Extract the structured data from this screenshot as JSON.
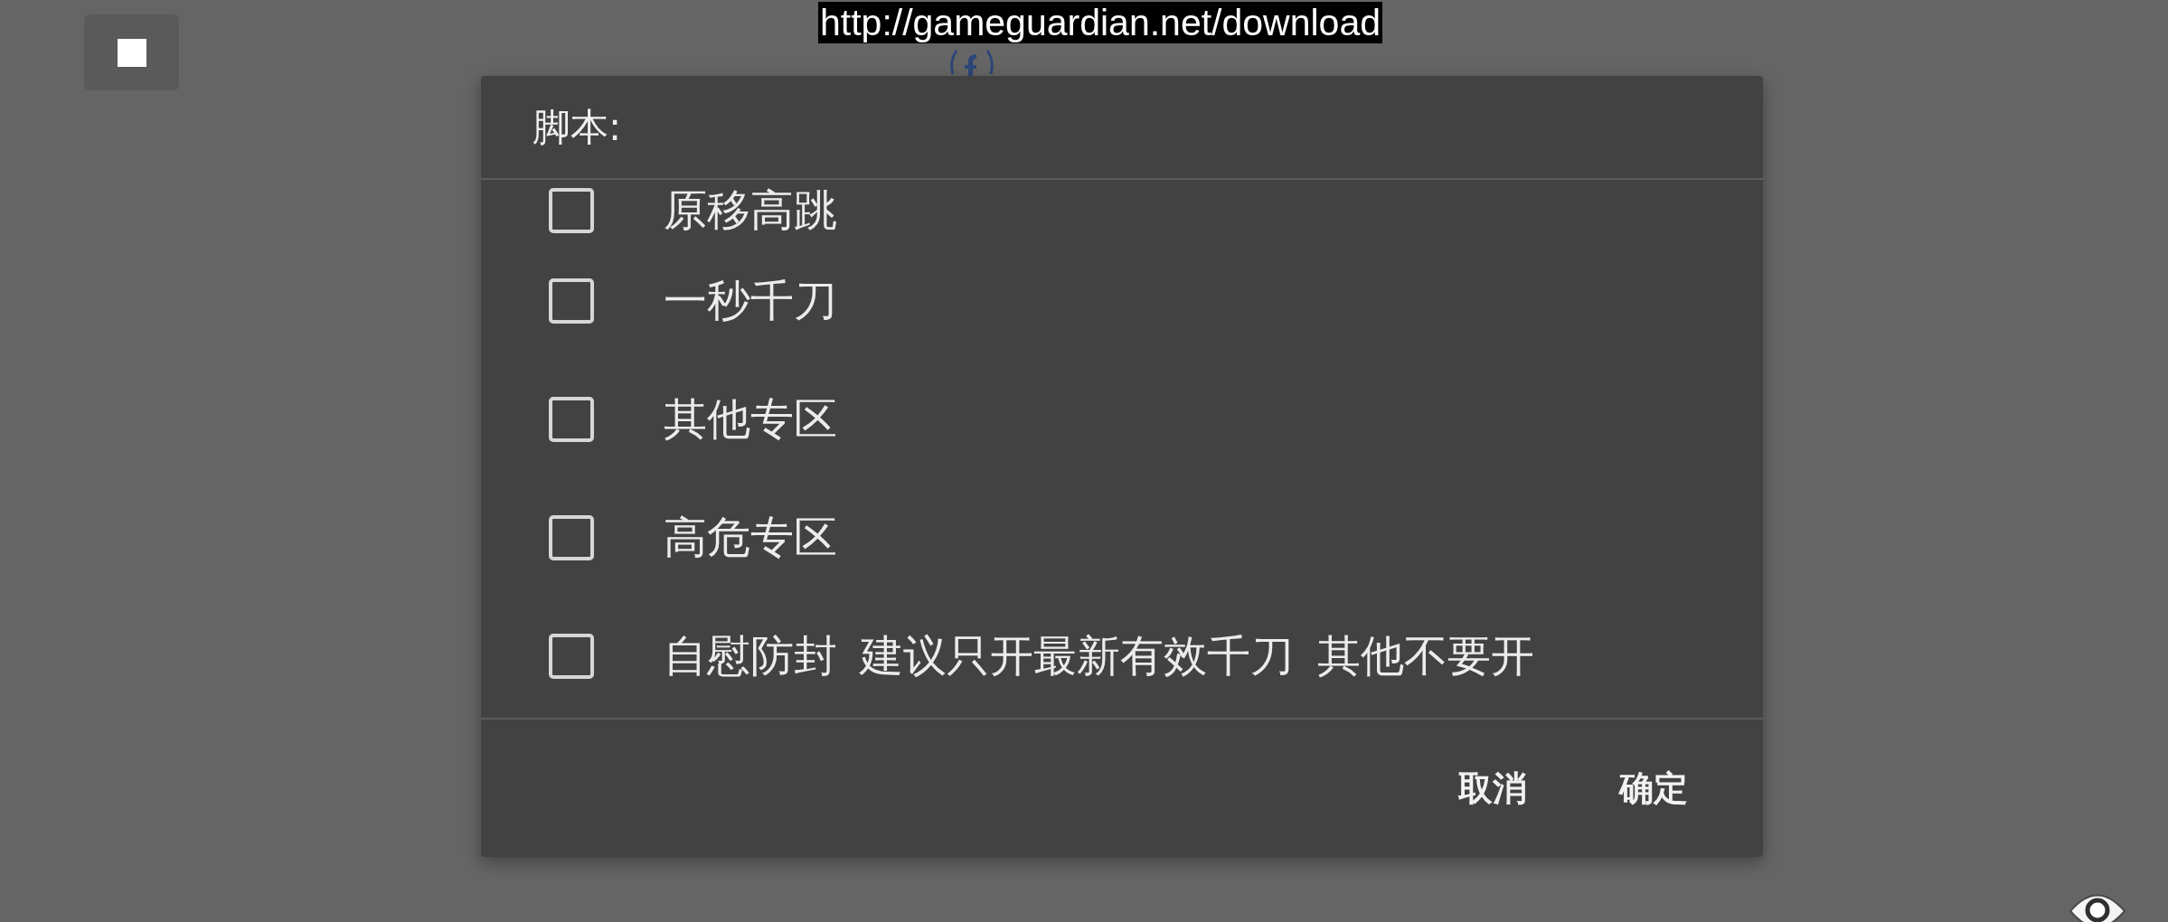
{
  "top_bar": {
    "url_label": "http://gameguardian.net/download"
  },
  "dialog": {
    "title": "脚本:",
    "options": [
      {
        "label": "原移高跳",
        "checked": false
      },
      {
        "label": "一秒千刀",
        "checked": false
      },
      {
        "label": "其他专区",
        "checked": false
      },
      {
        "label": "高危专区",
        "checked": false
      },
      {
        "label": "自慰防封 建议只开最新有效千刀 其他不要开",
        "checked": false
      }
    ],
    "buttons": [
      "取消",
      "确定"
    ]
  }
}
